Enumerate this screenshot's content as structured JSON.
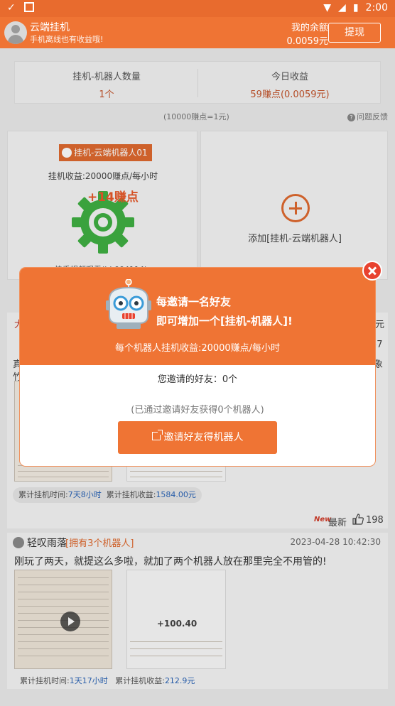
{
  "status_bar": {
    "time": "2:00"
  },
  "header": {
    "title": "云端挂机",
    "subtitle": "手机离线也有收益哦!",
    "balance_label": "我的余额",
    "balance_value": "0.0059元",
    "withdraw_label": "提现"
  },
  "stats": {
    "robots_label": "挂机-机器人数量",
    "robots_value": "1个",
    "today_label": "今日收益",
    "today_value": "59赚点(0.0059元)",
    "rate_note": "(10000赚点=1元)",
    "feedback_label": "问题反馈"
  },
  "robot_card": {
    "tag": "挂机-云端机器人01",
    "earning": "挂机收益:20000赚点/每小时",
    "floating_gain": "+14赚点",
    "watching": "快手视频观看(id:004114)"
  },
  "add_card": {
    "label": "添加[挂机-云端机器人]"
  },
  "modal": {
    "title_line1": "每邀请一名好友",
    "title_line2": "即可增加一个[挂机-机器人]!",
    "per_robot": "每个机器人挂机收益:20000赚点/每小时",
    "friends_invited": "您邀请的好友：0个",
    "robots_obtained": "(已通过邀请好友获得0个机器人)",
    "invite_button": "邀请好友得机器人"
  },
  "feed": {
    "section_fragment": "大",
    "fragment_right1": "元",
    "fragment_right2": "57",
    "fragment_left": "真",
    "fragment_left2": "竹",
    "fragment_right3": "象",
    "post1_hang_label": "累计挂机时间:",
    "post1_hang_value": "7天8小时",
    "post1_earn_label": "累计挂机收益:",
    "post1_earn_value": "1584.00元",
    "sort_new_tag": "New",
    "sort_label": "最新",
    "like_count": "198",
    "post2": {
      "user": "轻叹雨落",
      "badge": "[拥有3个机器人]",
      "time": "2023-04-28 10:42:30",
      "text": "刚玩了两天，就提这么多啦，就加了两个机器人放在那里完全不用管的!",
      "amount": "+100.40",
      "hang_label": "累计挂机时间:",
      "hang_value": "1天17小时",
      "earn_label": "累计挂机收益:",
      "earn_value": "212.9元"
    }
  },
  "colors": {
    "brand": "#ef7434",
    "accent_red": "#e8422f",
    "link_blue": "#2a64b7"
  }
}
